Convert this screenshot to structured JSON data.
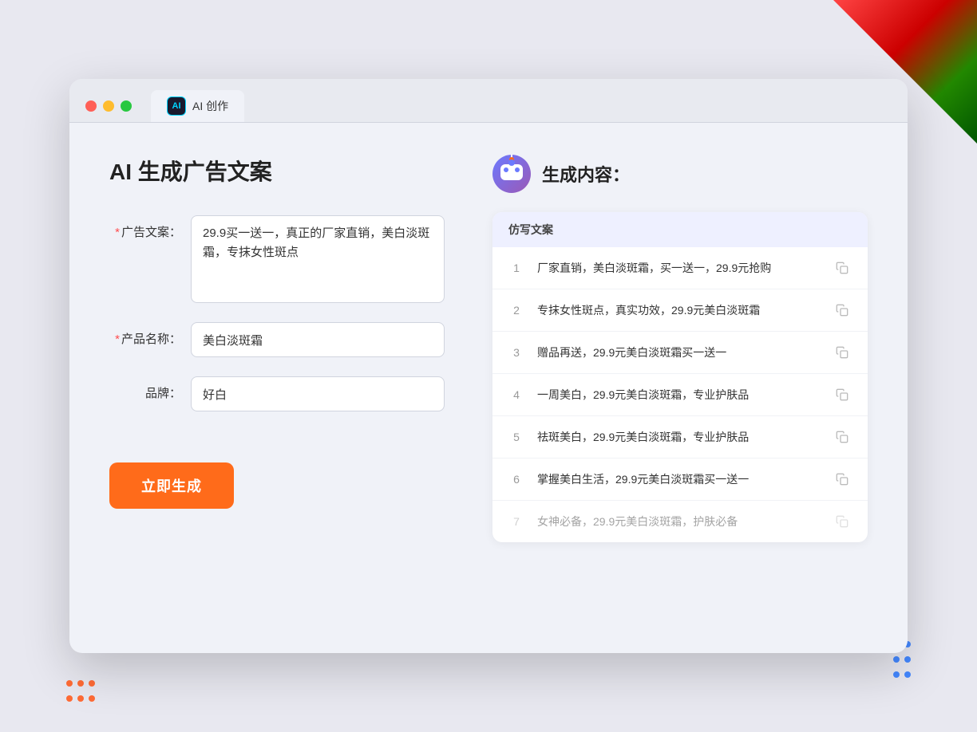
{
  "window": {
    "title": "AI 创作",
    "tab_label": "AI 创作",
    "ai_icon_text": "AI"
  },
  "traffic_lights": {
    "red_label": "close",
    "yellow_label": "minimize",
    "green_label": "maximize"
  },
  "left_panel": {
    "page_title": "AI 生成广告文案",
    "form": {
      "ad_copy_label": "广告文案：",
      "ad_copy_required": "*",
      "ad_copy_value": "29.9买一送一，真正的厂家直销，美白淡斑霜，专抹女性斑点",
      "product_name_label": "产品名称：",
      "product_name_required": "*",
      "product_name_value": "美白淡斑霜",
      "brand_label": "品牌：",
      "brand_value": "好白"
    },
    "generate_button": "立即生成"
  },
  "right_panel": {
    "result_title": "生成内容：",
    "table_header": "仿写文案",
    "results": [
      {
        "num": "1",
        "text": "厂家直销，美白淡斑霜，买一送一，29.9元抢购",
        "dim": false
      },
      {
        "num": "2",
        "text": "专抹女性斑点，真实功效，29.9元美白淡斑霜",
        "dim": false
      },
      {
        "num": "3",
        "text": "赠品再送，29.9元美白淡斑霜买一送一",
        "dim": false
      },
      {
        "num": "4",
        "text": "一周美白，29.9元美白淡斑霜，专业护肤品",
        "dim": false
      },
      {
        "num": "5",
        "text": "祛斑美白，29.9元美白淡斑霜，专业护肤品",
        "dim": false
      },
      {
        "num": "6",
        "text": "掌握美白生活，29.9元美白淡斑霜买一送一",
        "dim": false
      },
      {
        "num": "7",
        "text": "女神必备，29.9元美白淡斑霜，护肤必备",
        "dim": true
      }
    ]
  }
}
